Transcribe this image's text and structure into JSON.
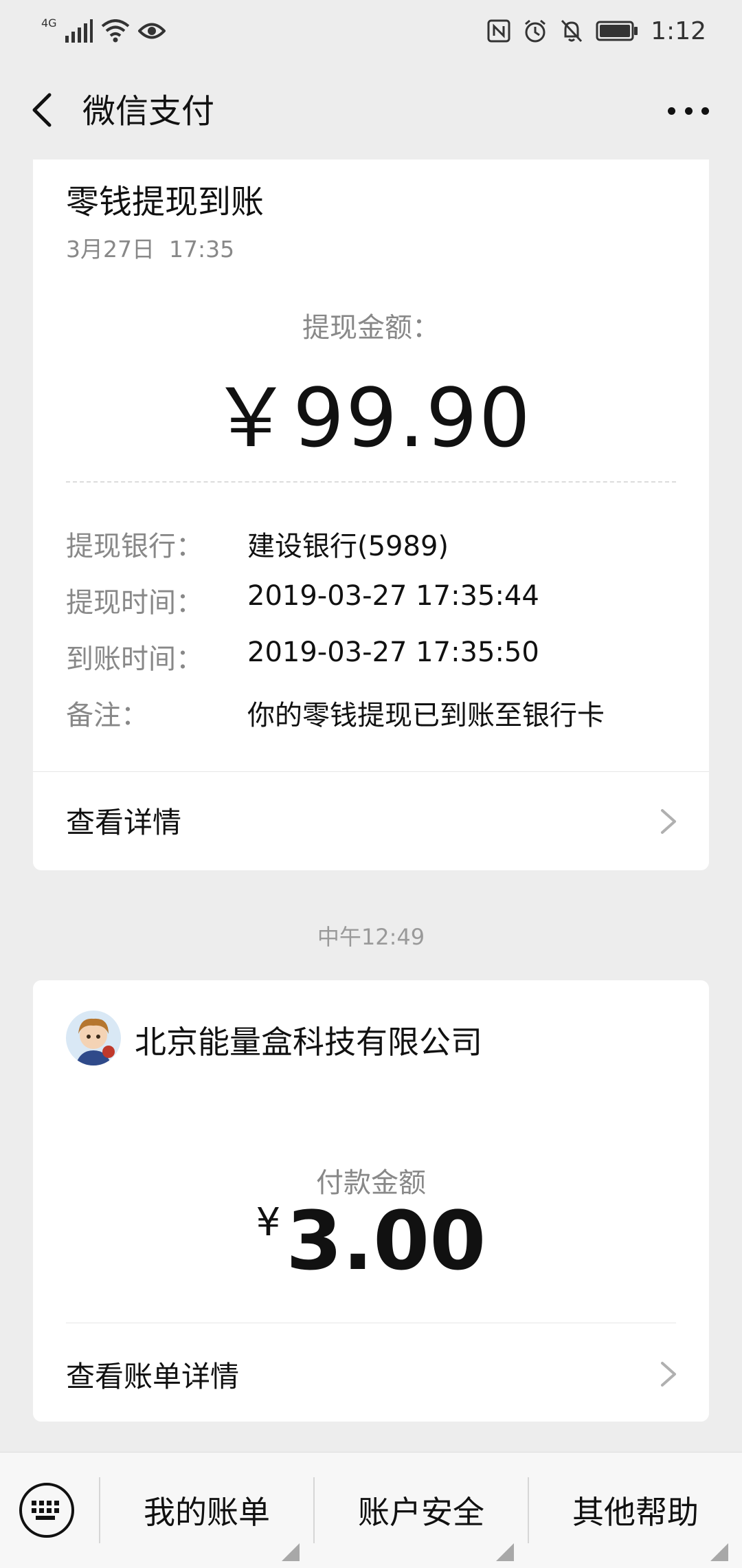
{
  "status_bar": {
    "network": "4G",
    "time": "1:12",
    "icons": [
      "signal-icon",
      "wifi-icon",
      "eye-icon",
      "nfc-icon",
      "alarm-icon",
      "mute-icon",
      "battery-icon"
    ]
  },
  "navbar": {
    "title": "微信支付"
  },
  "withdrawal_card": {
    "title": "零钱提现到账",
    "date": "3月27日  17:35",
    "amount_label": "提现金额：",
    "amount": "￥99.90",
    "details": [
      {
        "key": "提现银行：",
        "value": "建设银行(5989)"
      },
      {
        "key": "提现时间：",
        "value": "2019-03-27 17:35:44"
      },
      {
        "key": "到账时间：",
        "value": "2019-03-27 17:35:50"
      },
      {
        "key": "备注：",
        "value": "你的零钱提现已到账至银行卡"
      }
    ],
    "link": "查看详情"
  },
  "time_separator": "中午12:49",
  "payment_card": {
    "merchant": "北京能量盒科技有限公司",
    "amount_label": "付款金额",
    "currency": "¥",
    "amount": "3.00",
    "link": "查看账单详情"
  },
  "bottom_menu": {
    "items": [
      "我的账单",
      "账户安全",
      "其他帮助"
    ]
  }
}
